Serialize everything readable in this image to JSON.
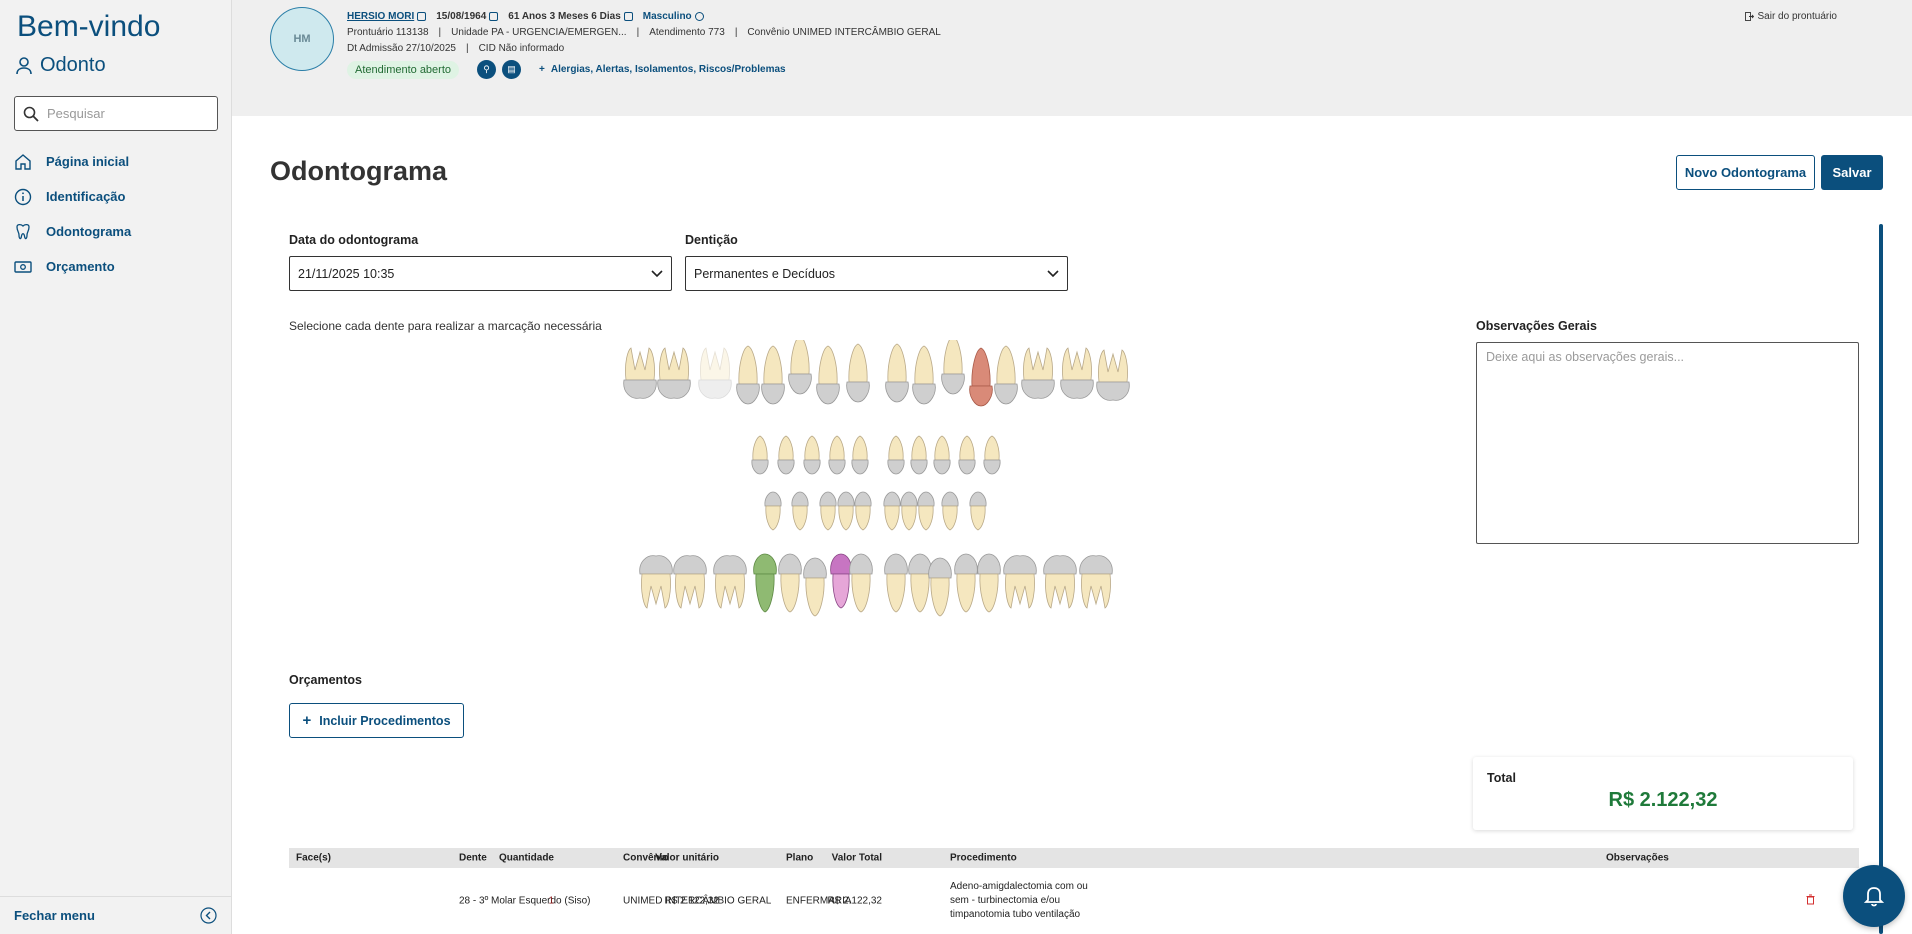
{
  "sidebar": {
    "title": "Bem-vindo",
    "module": "Odonto",
    "search_placeholder": "Pesquisar",
    "items": [
      {
        "label": "Página inicial",
        "icon": "home-icon"
      },
      {
        "label": "Identificação",
        "icon": "info-icon"
      },
      {
        "label": "Odontograma",
        "icon": "tooth-icon"
      },
      {
        "label": "Orçamento",
        "icon": "money-icon"
      }
    ],
    "footer_label": "Fechar menu"
  },
  "patient": {
    "initials": "HM",
    "name": "HERSIO MORI",
    "birth_date": "15/08/1964",
    "age": "61 Anos 3 Meses 6 Dias",
    "sex": "Masculino",
    "prontuario": "Prontuário 113138",
    "unidade": "Unidade PA - URGENCIA/EMERGEN...",
    "atendimento": "Atendimento 773",
    "convenio": "Convênio UNIMED INTERCÂMBIO GERAL",
    "admissao": "Dt Admissão 27/10/2025",
    "cid": "CID Não informado",
    "status": "Atendimento aberto",
    "alerts_link": "Alergias, Alertas, Isolamentos, Riscos/Problemas",
    "logout": "Sair do prontuário"
  },
  "page": {
    "title": "Odontograma",
    "new_button": "Novo Odontograma",
    "save_button": "Salvar",
    "date_label": "Data do odontograma",
    "date_value": "21/11/2025 10:35",
    "dentition_label": "Dentição",
    "dentition_value": "Permanentes e Decíduos",
    "hint": "Selecione cada dente para realizar a marcação necessária",
    "obs_label": "Observações Gerais",
    "obs_placeholder": "Deixe aqui as observações gerais...",
    "budgets_label": "Orçamentos",
    "add_button": "Incluir Procedimentos",
    "total_label": "Total",
    "total_value": "R$ 2.122,32"
  },
  "table": {
    "headers": [
      "Face(s)",
      "Dente",
      "Convênio",
      "Plano",
      "Procedimento",
      "Quantidade",
      "Valor unitário",
      "Valor Total",
      "Observações"
    ],
    "rows": [
      {
        "face": "",
        "dente": "28 - 3º Molar Esquerdo (Siso)",
        "convenio": "UNIMED INTERCÂMBIO GERAL",
        "plano": "ENFERMARIA",
        "procedimento": "Adeno-amigdalectomia com ou sem - turbinectomia e/ou timpanotomia tubo ventilação",
        "quantidade": "1",
        "valor_unitario": "R$ 2.122,32",
        "valor_total": "R$ 2.122,32",
        "observacoes": ""
      }
    ]
  },
  "colors": {
    "primary": "#0b4f7d",
    "total_green": "#1f7a3a",
    "tooth_red": "#d98a78",
    "tooth_green": "#8fba72",
    "tooth_pink": "#c775c2"
  }
}
